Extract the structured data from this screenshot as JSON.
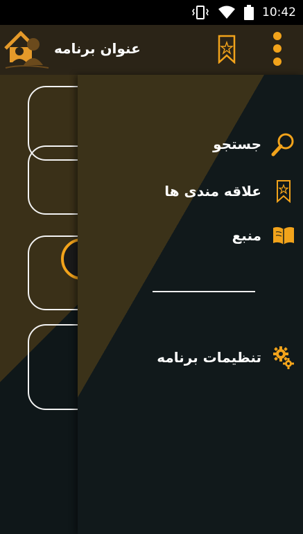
{
  "status_bar": {
    "time": "10:42"
  },
  "app_bar": {
    "title": "عنوان برنامه"
  },
  "drawer": {
    "items": [
      {
        "label": "جستجو",
        "icon": "search-icon"
      },
      {
        "label": "علاقه مندی ها",
        "icon": "bookmark-star-icon"
      },
      {
        "label": "منبع",
        "icon": "book-icon"
      },
      {
        "label": "تنظیمات برنامه",
        "icon": "gears-icon"
      }
    ]
  },
  "colors": {
    "accent": "#f2a31b",
    "bg_dark": "#0f1719",
    "bg_brown": "#3a3018"
  }
}
